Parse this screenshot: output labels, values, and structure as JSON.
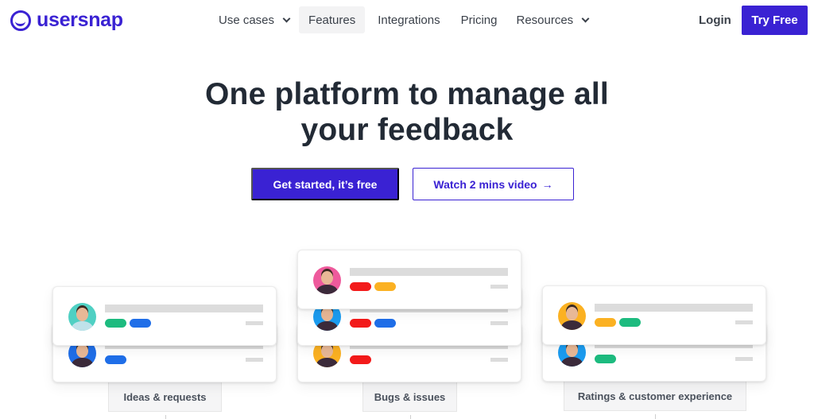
{
  "brand": {
    "name": "usersnap",
    "accent": "#3a22d3",
    "logo_icon": "smile-circle-icon"
  },
  "nav": {
    "items": [
      {
        "label": "Use cases",
        "has_dropdown": true,
        "active": false
      },
      {
        "label": "Features",
        "has_dropdown": false,
        "active": true
      },
      {
        "label": "Integrations",
        "has_dropdown": false,
        "active": false
      },
      {
        "label": "Pricing",
        "has_dropdown": false,
        "active": false
      },
      {
        "label": "Resources",
        "has_dropdown": true,
        "active": false
      }
    ],
    "login": "Login",
    "try_free": "Try Free"
  },
  "hero": {
    "title_line1": "One platform to manage all",
    "title_line2": "your feedback",
    "cta_primary": "Get started, it’s free",
    "cta_secondary": "Watch 2 mins video",
    "cta_secondary_icon": "arrow-right-icon",
    "arrow": "→"
  },
  "colors": {
    "green": "#1dbb7f",
    "blue": "#1f6ee8",
    "red": "#f31a1a",
    "orange": "#fbb122",
    "teal": "#4fd0c3",
    "pink": "#ee5a9c",
    "sky": "#1b9cf0"
  },
  "categories": [
    {
      "label": "Ideas & requests",
      "entries": [
        {
          "avatar_bg": "#4fd0c3",
          "tags": [
            "green",
            "blue"
          ]
        },
        {
          "avatar_bg": "#1f6ee8",
          "tags": [
            "blue"
          ]
        }
      ]
    },
    {
      "label": "Bugs & issues",
      "entries": [
        {
          "avatar_bg": "#ee5a9c",
          "tags": [
            "red",
            "orange"
          ]
        },
        {
          "avatar_bg": "#1b9cf0",
          "tags": [
            "red",
            "blue"
          ]
        },
        {
          "avatar_bg": "#fbb122",
          "tags": [
            "red"
          ]
        }
      ]
    },
    {
      "label": "Ratings  & customer experience",
      "entries": [
        {
          "avatar_bg": "#fbb122",
          "tags": [
            "orange",
            "green"
          ]
        },
        {
          "avatar_bg": "#1b9cf0",
          "tags": [
            "green"
          ]
        }
      ]
    }
  ]
}
